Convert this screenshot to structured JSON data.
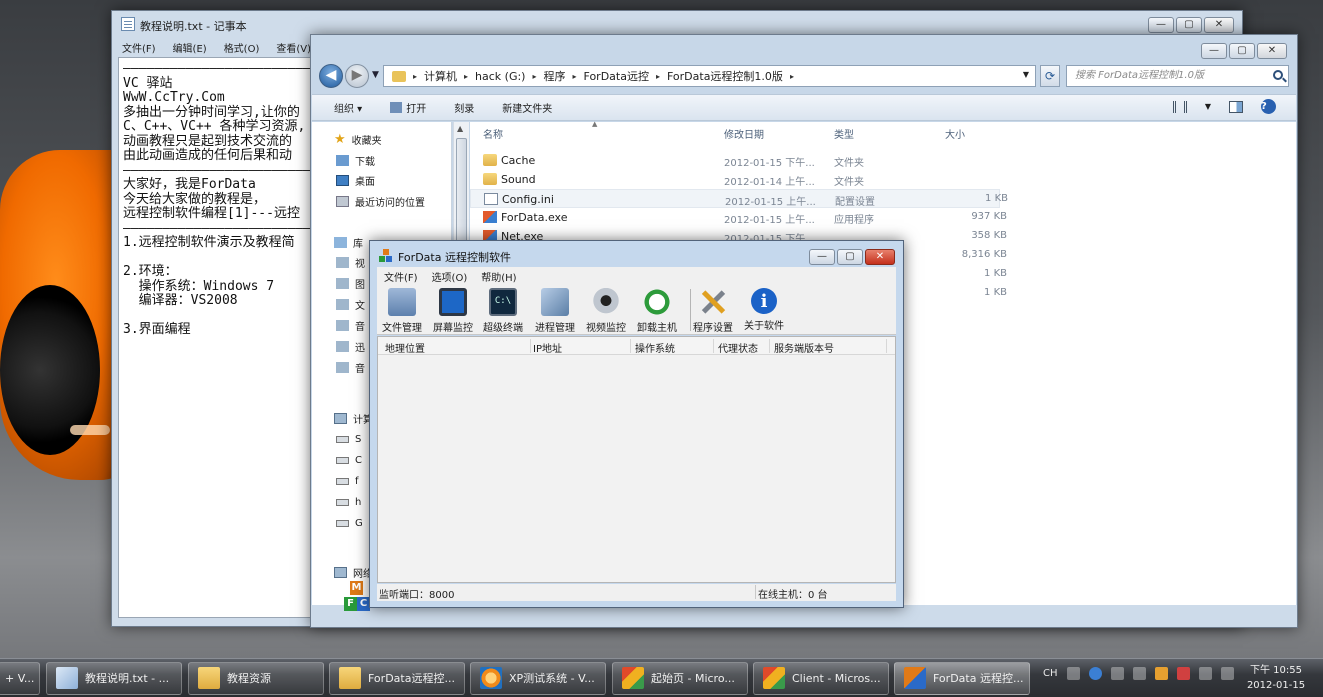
{
  "notepad": {
    "title": "教程说明.txt - 记事本",
    "menu": [
      "文件(F)",
      "编辑(E)",
      "格式(O)",
      "查看(V)"
    ],
    "content": "————————————————————————\nVC 驿站\nWwW.CcTry.Com\n多抽出一分钟时间学习,让你的\nC、C++、VC++ 各种学习资源,\n动画教程只是起到技术交流的\n由此动画造成的任何后果和动\n————————————————————————\n大家好，我是ForData\n今天给大家做的教程是，\n远程控制软件编程[1]---远控\n————————————————————————\n1.远程控制软件演示及教程简\n\n2.环境：\n  操作系统：Windows 7\n  编译器：VS2008\n\n3.界面编程"
  },
  "explorer": {
    "address": {
      "separator": "▸",
      "crumbs": [
        "计算机",
        "hack (G:)",
        "程序",
        "ForData远控",
        "ForData远程控制1.0版"
      ]
    },
    "search_placeholder": "搜索 ForData远程控制1.0版",
    "toolbar": {
      "organize": "组织 ▾",
      "open": "打开",
      "burn": "刻录",
      "new_folder": "新建文件夹"
    },
    "nav": {
      "favorites": "收藏夹",
      "favorite_items": [
        "下载",
        "桌面",
        "最近访问的位置"
      ],
      "libraries": "库",
      "library_items": [
        "视",
        "图",
        "文",
        "音",
        "迅",
        "音"
      ],
      "computer": "计算",
      "computer_items": [
        "S",
        "C",
        "f",
        "h",
        "G"
      ],
      "network": "网络"
    },
    "columns": {
      "name": "名称",
      "date": "修改日期",
      "type": "类型",
      "size": "大小"
    },
    "files": [
      {
        "name": "Cache",
        "date": "2012-01-15 下午...",
        "type": "文件夹",
        "size": "",
        "icon": "folder"
      },
      {
        "name": "Sound",
        "date": "2012-01-14 上午...",
        "type": "文件夹",
        "size": "",
        "icon": "folder"
      },
      {
        "name": "Config.ini",
        "date": "2012-01-15 上午...",
        "type": "配置设置",
        "size": "1 KB",
        "icon": "ini"
      },
      {
        "name": "ForData.exe",
        "date": "2012-01-15 上午...",
        "type": "应用程序",
        "size": "937 KB",
        "icon": "exe"
      },
      {
        "name": "Net.exe",
        "date": "2012-01-15 下午...",
        "type": "",
        "size": "358 KB",
        "icon": "exe"
      },
      {
        "name": "",
        "date": "",
        "type": "",
        "size": "8,316 KB",
        "icon": ""
      },
      {
        "name": "",
        "date": "",
        "type": "",
        "size": "1 KB",
        "icon": ""
      },
      {
        "name": "",
        "date": "",
        "type": "",
        "size": "1 KB",
        "icon": ""
      }
    ]
  },
  "fordata": {
    "title": "ForData 远程控制软件",
    "menu": [
      "文件(F)",
      "选项(O)",
      "帮助(H)"
    ],
    "tools": [
      "文件管理",
      "屏幕监控",
      "超级终端",
      "进程管理",
      "视频监控",
      "卸载主机",
      "程序设置",
      "关于软件"
    ],
    "terminal_glyph": "C:\\",
    "info_glyph": "i",
    "columns": [
      "地理位置",
      "IP地址",
      "操作系统",
      "代理状态",
      "服务端版本号"
    ],
    "status_left": "监听端口：8000",
    "status_right": "在线主机：0 台",
    "logo_letters": [
      "M",
      "F",
      "C"
    ]
  },
  "taskbar": {
    "start_fragment": "+ V...",
    "buttons": [
      {
        "label": "教程说明.txt - ...",
        "icon": "notepad"
      },
      {
        "label": "教程资源",
        "icon": "folder"
      },
      {
        "label": "ForData远程控...",
        "icon": "folder"
      },
      {
        "label": "XP测试系统 - V...",
        "icon": "vmware"
      },
      {
        "label": "起始页 - Micro...",
        "icon": "visual-studio"
      },
      {
        "label": "Client - Micros...",
        "icon": "visual-studio"
      },
      {
        "label": "ForData 远程控...",
        "icon": "mfc-app"
      }
    ],
    "tray_ime": "CH",
    "clock_time": "下午 10:55",
    "clock_date": "2012-01-15"
  },
  "caption_glyphs": {
    "minimize": "—",
    "maximize": "▢",
    "close": "✕"
  }
}
